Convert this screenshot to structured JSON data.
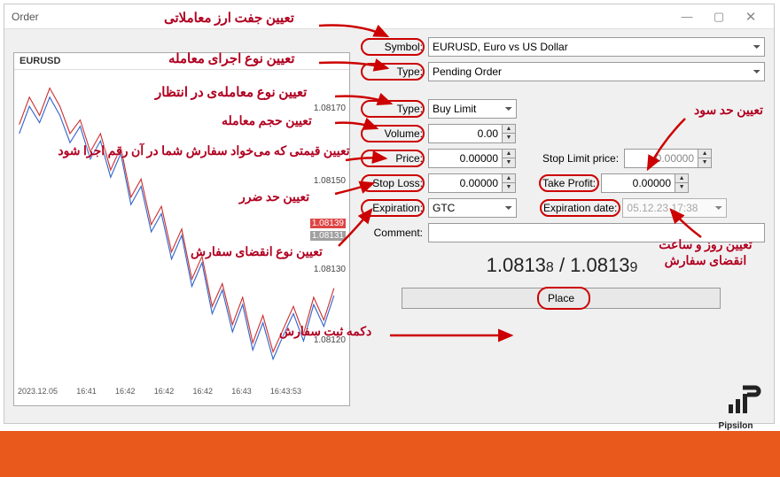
{
  "window": {
    "title": "Order"
  },
  "chart": {
    "symbol": "EURUSD",
    "yTicks": {
      "a": "1.08170",
      "b": "1.08150",
      "c": "1.08139",
      "d": "1.08131",
      "e": "1.08130",
      "f": "1.08120"
    },
    "xTicks": {
      "a": "2023.12.05",
      "b": "16:41",
      "c": "16:42",
      "d": "16:42",
      "e": "16:42",
      "f": "16:43",
      "g": "16:43:53"
    }
  },
  "form": {
    "symbol": {
      "label": "Symbol:",
      "value": "EURUSD, Euro vs US Dollar"
    },
    "orderType": {
      "label": "Type:",
      "value": "Pending Order"
    },
    "pendingType": {
      "label": "Type:",
      "value": "Buy Limit"
    },
    "volume": {
      "label": "Volume:",
      "value": "0.00"
    },
    "price": {
      "label": "Price:",
      "value": "0.00000"
    },
    "stopLoss": {
      "label": "Stop Loss:",
      "value": "0.00000"
    },
    "stopLimit": {
      "label": "Stop Limit price:",
      "value": "0.00000"
    },
    "takeProfit": {
      "label": "Take Profit:",
      "value": "0.00000"
    },
    "expiration": {
      "label": "Expiration:",
      "value": "GTC"
    },
    "expirationDate": {
      "label": "Expiration date:",
      "value": "05.12.23 17:38"
    },
    "comment": {
      "label": "Comment:",
      "value": ""
    },
    "quote": {
      "bidBig": "1.0813",
      "bidSm": "8",
      "sep": " / ",
      "askBig": "1.0813",
      "askSm": "9"
    },
    "place": "Place"
  },
  "ann": {
    "symbol": "تعیین جفت ارز معاملاتی",
    "orderType": "تعیین نوع اجرای معامله",
    "pendingType": "تعیین نوع معامله‌ی در انتظار",
    "volume": "تعیین حجم معامله",
    "price": "تعیین قیمتی که می‌خواد سفارش شما در آن رقم اجرا شود",
    "stopLoss": "تعیین حد ضرر",
    "expiration": "تعیین نوع انقضای سفارش",
    "takeProfit": "تعیین حد سود",
    "expirationDate": "تعیین روز و ساعت انقضای سفارش",
    "place": "دکمه ثبت سفارش"
  },
  "brand": "Pipsilon"
}
